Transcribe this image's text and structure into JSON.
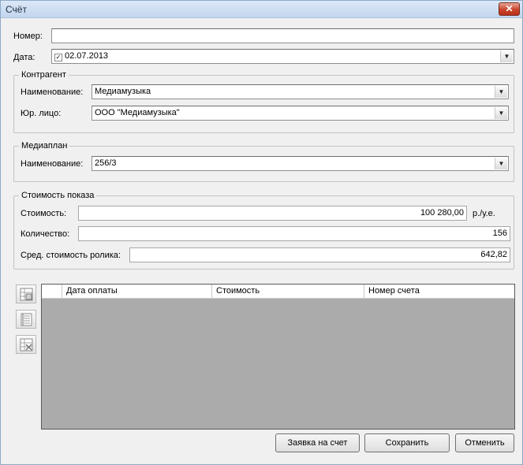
{
  "window": {
    "title": "Счёт",
    "close_label": "✕"
  },
  "form": {
    "number_label": "Номер:",
    "number_value": "",
    "date_label": "Дата:",
    "date_checked": "✓",
    "date_value": "02.07.2013"
  },
  "counterparty": {
    "title": "Контрагент",
    "name_label": "Наименование:",
    "name_value": "Медиамузыка",
    "legal_label": "Юр. лицо:",
    "legal_value": "ООО \"Медиамузыка\""
  },
  "mediaplan": {
    "title": "Медиаплан",
    "name_label": "Наименование:",
    "name_value": "256/3"
  },
  "cost": {
    "title": "Стоимость показа",
    "cost_label": "Стоимость:",
    "cost_value": "100 280,00",
    "currency": "р./у.е.",
    "qty_label": "Количество:",
    "qty_value": "156",
    "avg_label": "Сред. стоимость ролика:",
    "avg_value": "642,82"
  },
  "grid": {
    "columns": [
      "Дата оплаты",
      "Стоимость",
      "Номер счета"
    ],
    "rows": []
  },
  "side_buttons": [
    "add-row-icon",
    "edit-row-icon",
    "delete-row-icon"
  ],
  "buttons": {
    "request_label": "Заявка на счет",
    "save_label": "Сохранить",
    "cancel_label": "Отменить"
  }
}
